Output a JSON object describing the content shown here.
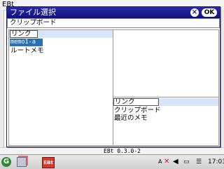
{
  "app": {
    "title": "EBt",
    "version": "EBt 0.3.0-2"
  },
  "dialog": {
    "title": "ファイル選択",
    "close_glyph": "×",
    "ok_label": "OK",
    "path": "クリップボード"
  },
  "left_pane": {
    "header": "リンク",
    "items": [
      {
        "label": "memo1-a",
        "selected": true
      },
      {
        "label": "ルートメモ",
        "selected": false
      }
    ]
  },
  "right_pane": {
    "header": "リンク",
    "items": [
      "クリップボード",
      "最近のメモ"
    ]
  },
  "taskbar": {
    "launcher_glyph": "G",
    "ebt_icon_text": "EBt",
    "ime_indicator": "A",
    "time": "17:03",
    "icons": [
      "launcher-icon",
      "cube-icon",
      "ebt-app-icon",
      "ime-icon",
      "network-off-icon",
      "volume-icon",
      "battery-icon",
      "tray-list-icon"
    ]
  }
}
